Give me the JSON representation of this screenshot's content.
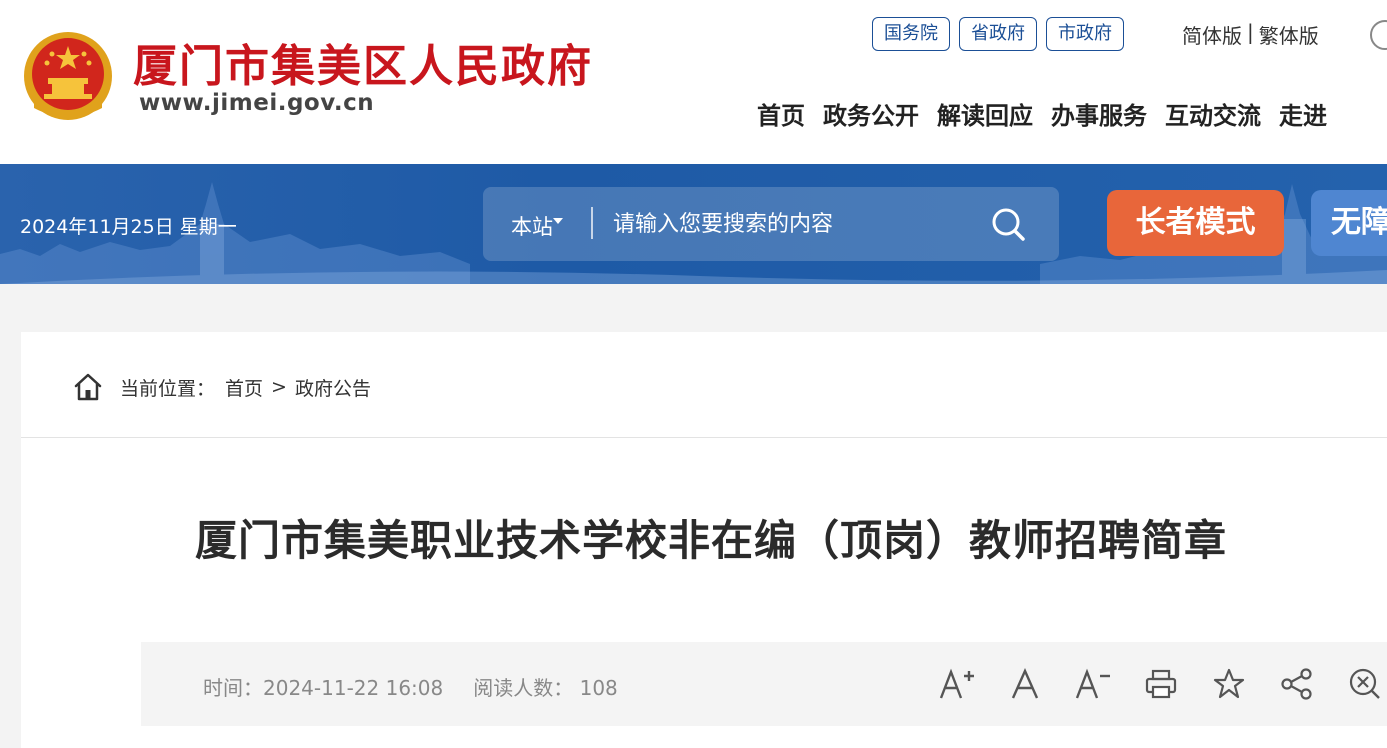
{
  "header": {
    "site_name": "厦门市集美区人民政府",
    "site_url": "www.jimei.gov.cn",
    "gov_links": [
      "国务院",
      "省政府",
      "市政府"
    ],
    "lang": {
      "simplified": "简体版",
      "separator": "|",
      "traditional": "繁体版"
    },
    "nav": [
      "首页",
      "政务公开",
      "解读回应",
      "办事服务",
      "互动交流",
      "走进"
    ]
  },
  "banner": {
    "date": "2024年11月25日 星期一",
    "search": {
      "scope": "本站",
      "placeholder": "请输入您要搜索的内容"
    },
    "elder_mode": "长者模式",
    "accessibility": "无障"
  },
  "breadcrumb": {
    "label": "当前位置：",
    "items": [
      "首页",
      "政府公告"
    ],
    "separator": ">"
  },
  "article": {
    "title": "厦门市集美职业技术学校非在编（顶岗）教师招聘简章",
    "time_label": "时间：",
    "time": "2024-11-22 16:08",
    "reads_label": "阅读人数：",
    "reads": "108"
  },
  "colors": {
    "brand_red": "#c8161d",
    "banner_blue": "#1e5aa6",
    "elder_orange": "#e8663a",
    "access_blue": "#4f86d1"
  },
  "icons": [
    "national-emblem-icon",
    "search-icon",
    "home-icon",
    "font-increase-icon",
    "font-reset-icon",
    "font-decrease-icon",
    "print-icon",
    "star-icon",
    "share-icon",
    "close-icon"
  ]
}
